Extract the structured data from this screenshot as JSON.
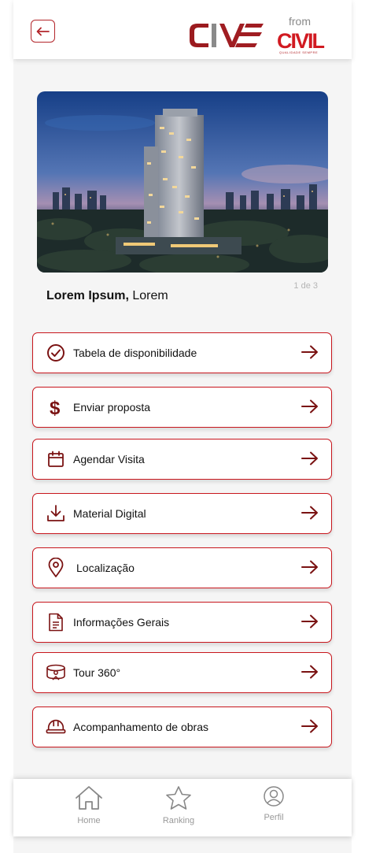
{
  "header": {
    "back_icon": "arrow-left-icon",
    "brand_logo": "CIVE",
    "from_label": "from",
    "parent_logo": "CIVIL",
    "parent_tagline": "QUALIDADE SEMPRE"
  },
  "gallery": {
    "counter": "1 de 3"
  },
  "property": {
    "name": "Lorem Ipsum,",
    "location": " Lorem"
  },
  "menu": [
    {
      "label": "Tabela de disponibilidade",
      "icon": "check-circle-icon"
    },
    {
      "label": "Enviar proposta",
      "icon": "dollar-icon"
    },
    {
      "label": "Agendar Visita",
      "icon": "calendar-icon"
    },
    {
      "label": "Material Digital",
      "icon": "download-icon"
    },
    {
      "label": "Localização",
      "icon": "location-pin-icon"
    },
    {
      "label": "Informações Gerais",
      "icon": "document-icon"
    },
    {
      "label": "Tour 360°",
      "icon": "vr-360-icon"
    },
    {
      "label": "Acompanhamento de obras",
      "icon": "hard-hat-icon"
    }
  ],
  "bottom_nav": [
    {
      "label": "Home",
      "icon": "home-icon"
    },
    {
      "label": "Ranking",
      "icon": "star-icon"
    },
    {
      "label": "Perfil",
      "icon": "user-icon"
    }
  ],
  "colors": {
    "accent": "#b3262b",
    "arrow": "#7a1212",
    "background": "#f5f5f5"
  }
}
